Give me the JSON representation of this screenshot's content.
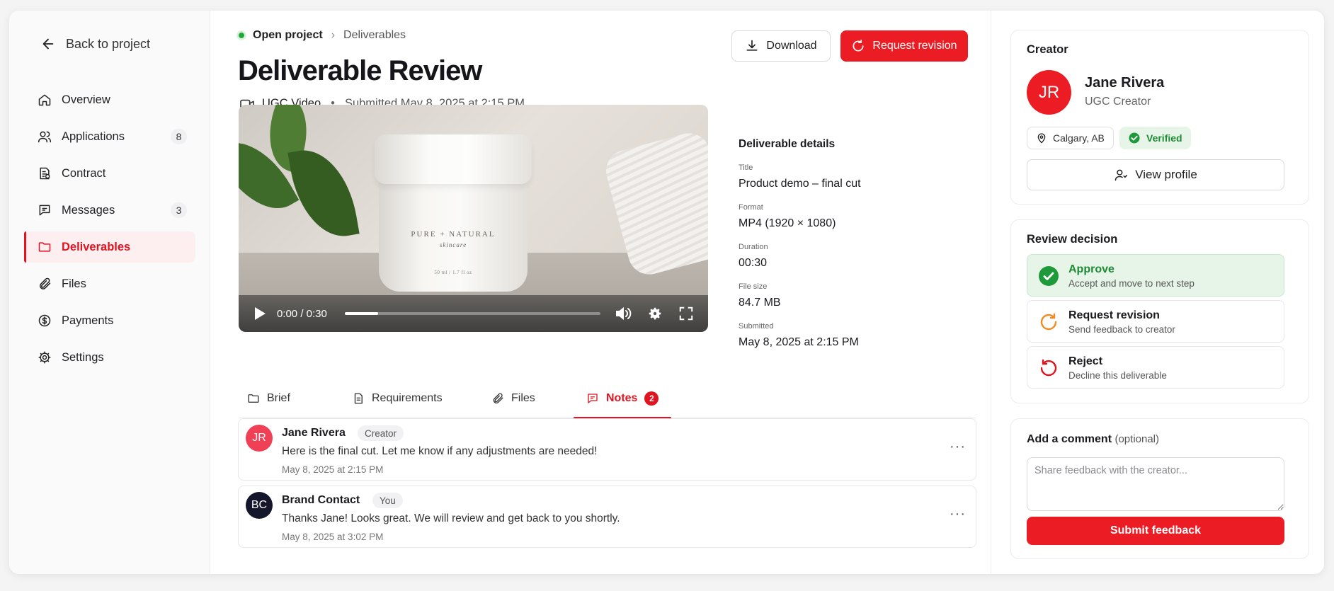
{
  "sidebar": {
    "back_label": "Back to project",
    "items": [
      {
        "label": "Overview",
        "icon": "home-icon",
        "badge": ""
      },
      {
        "label": "Applications",
        "icon": "users-icon",
        "badge": "8"
      },
      {
        "label": "Contract",
        "icon": "contract-icon",
        "badge": ""
      },
      {
        "label": "Messages",
        "icon": "message-icon",
        "badge": "3"
      },
      {
        "label": "Deliverables",
        "icon": "folder-icon",
        "badge": ""
      },
      {
        "label": "Files",
        "icon": "paperclip-icon",
        "badge": ""
      },
      {
        "label": "Payments",
        "icon": "dollar-icon",
        "badge": ""
      },
      {
        "label": "Settings",
        "icon": "gear-icon",
        "badge": ""
      }
    ],
    "active": "Deliverables"
  },
  "breadcrumb": {
    "project": "Open project",
    "current": "Deliverables"
  },
  "header": {
    "title": "Deliverable Review",
    "type": "UGC Video",
    "submitted": "Submitted May 8, 2025 at 2:15 PM",
    "download_label": "Download",
    "request_revision_label": "Request revision"
  },
  "video": {
    "time": "0:00 / 0:30",
    "progress": 0.13,
    "product_label": "PURE + NATURAL",
    "product_sub": "skincare",
    "product_size": "50 ml / 1.7 fl oz"
  },
  "details": {
    "heading": "Deliverable details",
    "fields": [
      {
        "label": "Title",
        "value": "Product demo – final cut"
      },
      {
        "label": "Format",
        "value": "MP4 (1920 × 1080)"
      },
      {
        "label": "Duration",
        "value": "00:30"
      },
      {
        "label": "File size",
        "value": "84.7 MB"
      },
      {
        "label": "Submitted",
        "value": "May 8, 2025 at 2:15 PM"
      }
    ]
  },
  "tabs": [
    {
      "label": "Brief",
      "icon": "folder-icon"
    },
    {
      "label": "Requirements",
      "icon": "document-icon"
    },
    {
      "label": "Files",
      "icon": "paperclip-icon"
    },
    {
      "label": "Notes",
      "icon": "message-icon",
      "badge": "2"
    }
  ],
  "notes": [
    {
      "initials": "JR",
      "name": "Jane Rivera",
      "role": "Creator",
      "text": "Here is the final cut. Let me know if any adjustments are needed!",
      "time": "May 8, 2025 at 2:15 PM",
      "color": "#ef4056"
    },
    {
      "initials": "BC",
      "name": "Brand Contact",
      "role": "You",
      "text": "Thanks Jane! Looks great. We will review and get back to you shortly.",
      "time": "May 8, 2025 at 3:02 PM",
      "color": "#14172b"
    }
  ],
  "creator": {
    "heading": "Creator",
    "initials": "JR",
    "name": "Jane Rivera",
    "role": "UGC Creator",
    "location": "Calgary, AB",
    "verified": "Verified",
    "view_profile": "View profile"
  },
  "review": {
    "heading": "Review decision",
    "options": [
      {
        "title": "Approve",
        "subtitle": "Accept and move to next step"
      },
      {
        "title": "Request revision",
        "subtitle": "Send feedback to creator"
      },
      {
        "title": "Reject",
        "subtitle": "Decline this deliverable"
      }
    ],
    "selected": "Approve"
  },
  "comment": {
    "heading": "Add a comment",
    "optional": "(optional)",
    "placeholder": "Share feedback with the creator...",
    "submit_label": "Submit feedback"
  },
  "colors": {
    "accent": "#ec1c24",
    "success": "#1f8a35",
    "success_bg": "#e6f5e8"
  }
}
